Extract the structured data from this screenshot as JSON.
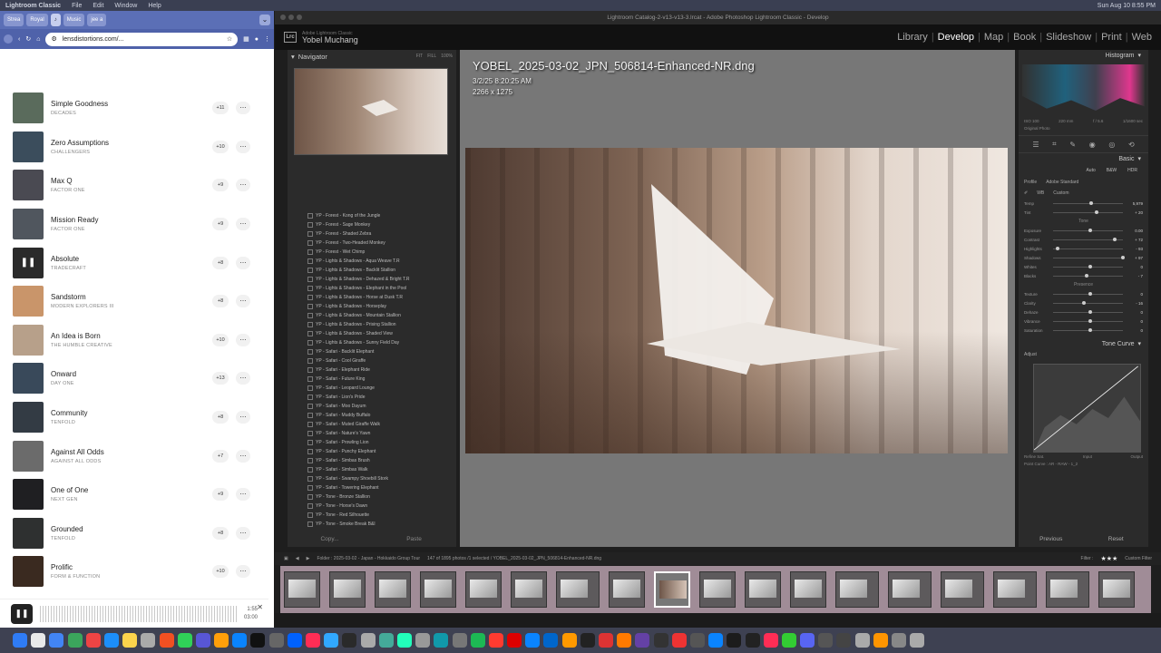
{
  "menubar": {
    "app": "Lightroom Classic",
    "items": [
      "File",
      "Edit",
      "Window",
      "Help"
    ],
    "clock": "Sun Aug 10 8:55 PM"
  },
  "browser": {
    "tabs": [
      {
        "label": "Strea"
      },
      {
        "label": "Royal"
      },
      {
        "label": "Music"
      },
      {
        "label": "jee a"
      }
    ],
    "url": "lensdistortions.com/...",
    "tracks": [
      {
        "name": "Simple Goodness",
        "sub": "DECADES",
        "count": "+11",
        "color": "#5a6b5c"
      },
      {
        "name": "Zero Assumptions",
        "sub": "CHALLENGERS",
        "count": "+10",
        "color": "#3b4d5c"
      },
      {
        "name": "Max Q",
        "sub": "FACTOR ONE",
        "count": "+9",
        "color": "#4a4a52"
      },
      {
        "name": "Mission Ready",
        "sub": "FACTOR ONE",
        "count": "+9",
        "color": "#50565e"
      },
      {
        "name": "Absolute",
        "sub": "TRADECRAFT",
        "count": "+8",
        "color": "#2b2b2b",
        "playing": true
      },
      {
        "name": "Sandstorm",
        "sub": "MODERN EXPLORERS III",
        "count": "+8",
        "color": "#c9956a"
      },
      {
        "name": "An Idea is Born",
        "sub": "THE HUMBLE CREATIVE",
        "count": "+10",
        "color": "#b7a08a"
      },
      {
        "name": "Onward",
        "sub": "DAY ONE",
        "count": "+13",
        "color": "#39495a"
      },
      {
        "name": "Community",
        "sub": "TENFOLD",
        "count": "+8",
        "color": "#333b44"
      },
      {
        "name": "Against All Odds",
        "sub": "AGAINST ALL ODDS",
        "count": "+7",
        "color": "#6b6b6b"
      },
      {
        "name": "One of One",
        "sub": "NEXT GEN",
        "count": "+9",
        "color": "#1f1f22"
      },
      {
        "name": "Grounded",
        "sub": "TENFOLD",
        "count": "+8",
        "color": "#2e3030"
      },
      {
        "name": "Prolific",
        "sub": "FORM & FUNCTION",
        "count": "+10",
        "color": "#3a2a20"
      }
    ],
    "player": {
      "elapsed": "1:55",
      "total": "03:00"
    }
  },
  "lr": {
    "window_title": "Lightroom Catalog-2-v13-v13-3.lrcat - Adobe Photoshop Lightroom Classic - Develop",
    "identity_top": "Adobe Lightroom Classic",
    "identity_name": "Yobel Muchang",
    "modules": [
      "Library",
      "Develop",
      "Map",
      "Book",
      "Slideshow",
      "Print",
      "Web"
    ],
    "active_module": "Develop",
    "navigator": {
      "title": "Navigator",
      "sizes": [
        "FIT",
        "FILL",
        "100%"
      ]
    },
    "presets": [
      "YP - Forest - Kong of the Jungle",
      "YP - Forest - Sage Monkey",
      "YP - Forest - Shaded Zebra",
      "YP - Forest - Two-Headed Monkey",
      "YP - Forest - Wet Chimp",
      "YP - Lights & Shadows - Aqua Weave T.R",
      "YP - Lights & Shadows - Backlit Stallion",
      "YP - Lights & Shadows - Dehazed & Bright T.R",
      "YP - Lights & Shadows - Elephant in the Pool",
      "YP - Lights & Shadows - Horse at Dusk T.R",
      "YP - Lights & Shadows - Horseplay",
      "YP - Lights & Shadows - Mountain Stallion",
      "YP - Lights & Shadows - Prising Stallion",
      "YP - Lights & Shadows - Shaded View",
      "YP - Lights & Shadows - Sunny Field Day",
      "YP - Safari - Backlit Elephant",
      "YP - Safari - Cool Giraffe",
      "YP - Safari - Elephant Ride",
      "YP - Safari - Future King",
      "YP - Safari - Leopard Lounge",
      "YP - Safari - Lion's Pride",
      "YP - Safari - Moo Dayum",
      "YP - Safari - Muddy Buffalo",
      "YP - Safari - Muted Giraffe Walk",
      "YP - Safari - Nature's Yawn",
      "YP - Safari - Prowling Lion",
      "YP - Safari - Punchy Elephant",
      "YP - Safari - Simbas Brush",
      "YP - Safari - Simbas Walk",
      "YP - Safari - Swampy Shoebill Stork",
      "YP - Safari - Towering Elephant",
      "YP - Tone - Bronze Stallion",
      "YP - Tone - Horse's Dawn",
      "YP - Tone - Red Silhouette",
      "YP - Tone - Smoke Break B&I"
    ],
    "left_buttons": {
      "copy": "Copy...",
      "paste": "Paste"
    },
    "image": {
      "filename": "YOBEL_2025-03-02_JPN_506814-Enhanced-NR.dng",
      "date": "3/2/25 8:20:25 AM",
      "dims": "2266 x 1275"
    },
    "right": {
      "histogram": "Histogram",
      "hist_info": [
        "ISO 100",
        "220 mm",
        "f / 5.6",
        "1/1600 sec"
      ],
      "original_photo": "Original Photo",
      "basic": "Basic",
      "treatments": [
        "Auto",
        "B&W",
        "HDR"
      ],
      "profile_label": "Profile",
      "profile_value": "Adobe Standard",
      "wb_label": "WB",
      "wb_value": "Custom",
      "sliders": [
        {
          "label": "Temp",
          "value": "5,979",
          "pos": 0.52
        },
        {
          "label": "Tint",
          "value": "+ 20",
          "pos": 0.6
        },
        {
          "label": "Exposure",
          "value": "0.00",
          "pos": 0.5
        },
        {
          "label": "Contrast",
          "value": "+ 72",
          "pos": 0.86
        },
        {
          "label": "Highlights",
          "value": "- 93",
          "pos": 0.04
        },
        {
          "label": "Shadows",
          "value": "+ 97",
          "pos": 0.98
        },
        {
          "label": "Whites",
          "value": "0",
          "pos": 0.5
        },
        {
          "label": "Blacks",
          "value": "- 7",
          "pos": 0.46
        },
        {
          "label": "Texture",
          "value": "0",
          "pos": 0.5
        },
        {
          "label": "Clarity",
          "value": "- 16",
          "pos": 0.42
        },
        {
          "label": "Dehaze",
          "value": "0",
          "pos": 0.5
        },
        {
          "label": "Vibrance",
          "value": "0",
          "pos": 0.5
        },
        {
          "label": "Saturation",
          "value": "0",
          "pos": 0.5
        }
      ],
      "tone_label": "Tone",
      "presence_label": "Presence",
      "tone_curve": "Tone Curve",
      "adjust_label": "Adjust",
      "refine_label": "Refine Sat.",
      "input_label": "Input",
      "output_label": "Output",
      "point_curve": "Point Curve : AR - RAW - 1_2",
      "previous": "Previous",
      "reset": "Reset"
    },
    "filmbar": {
      "folder": "Folder : 2025-03-02 - Japan - Hokkaido Group Tour",
      "count": "147 of 1895 photos /1 selected / YOBEL_2025-03-02_JPN_506814-Enhanced-NR.dng",
      "filter": "Filter :",
      "stars": "★★★",
      "custom_filter": "Custom Filter"
    }
  }
}
